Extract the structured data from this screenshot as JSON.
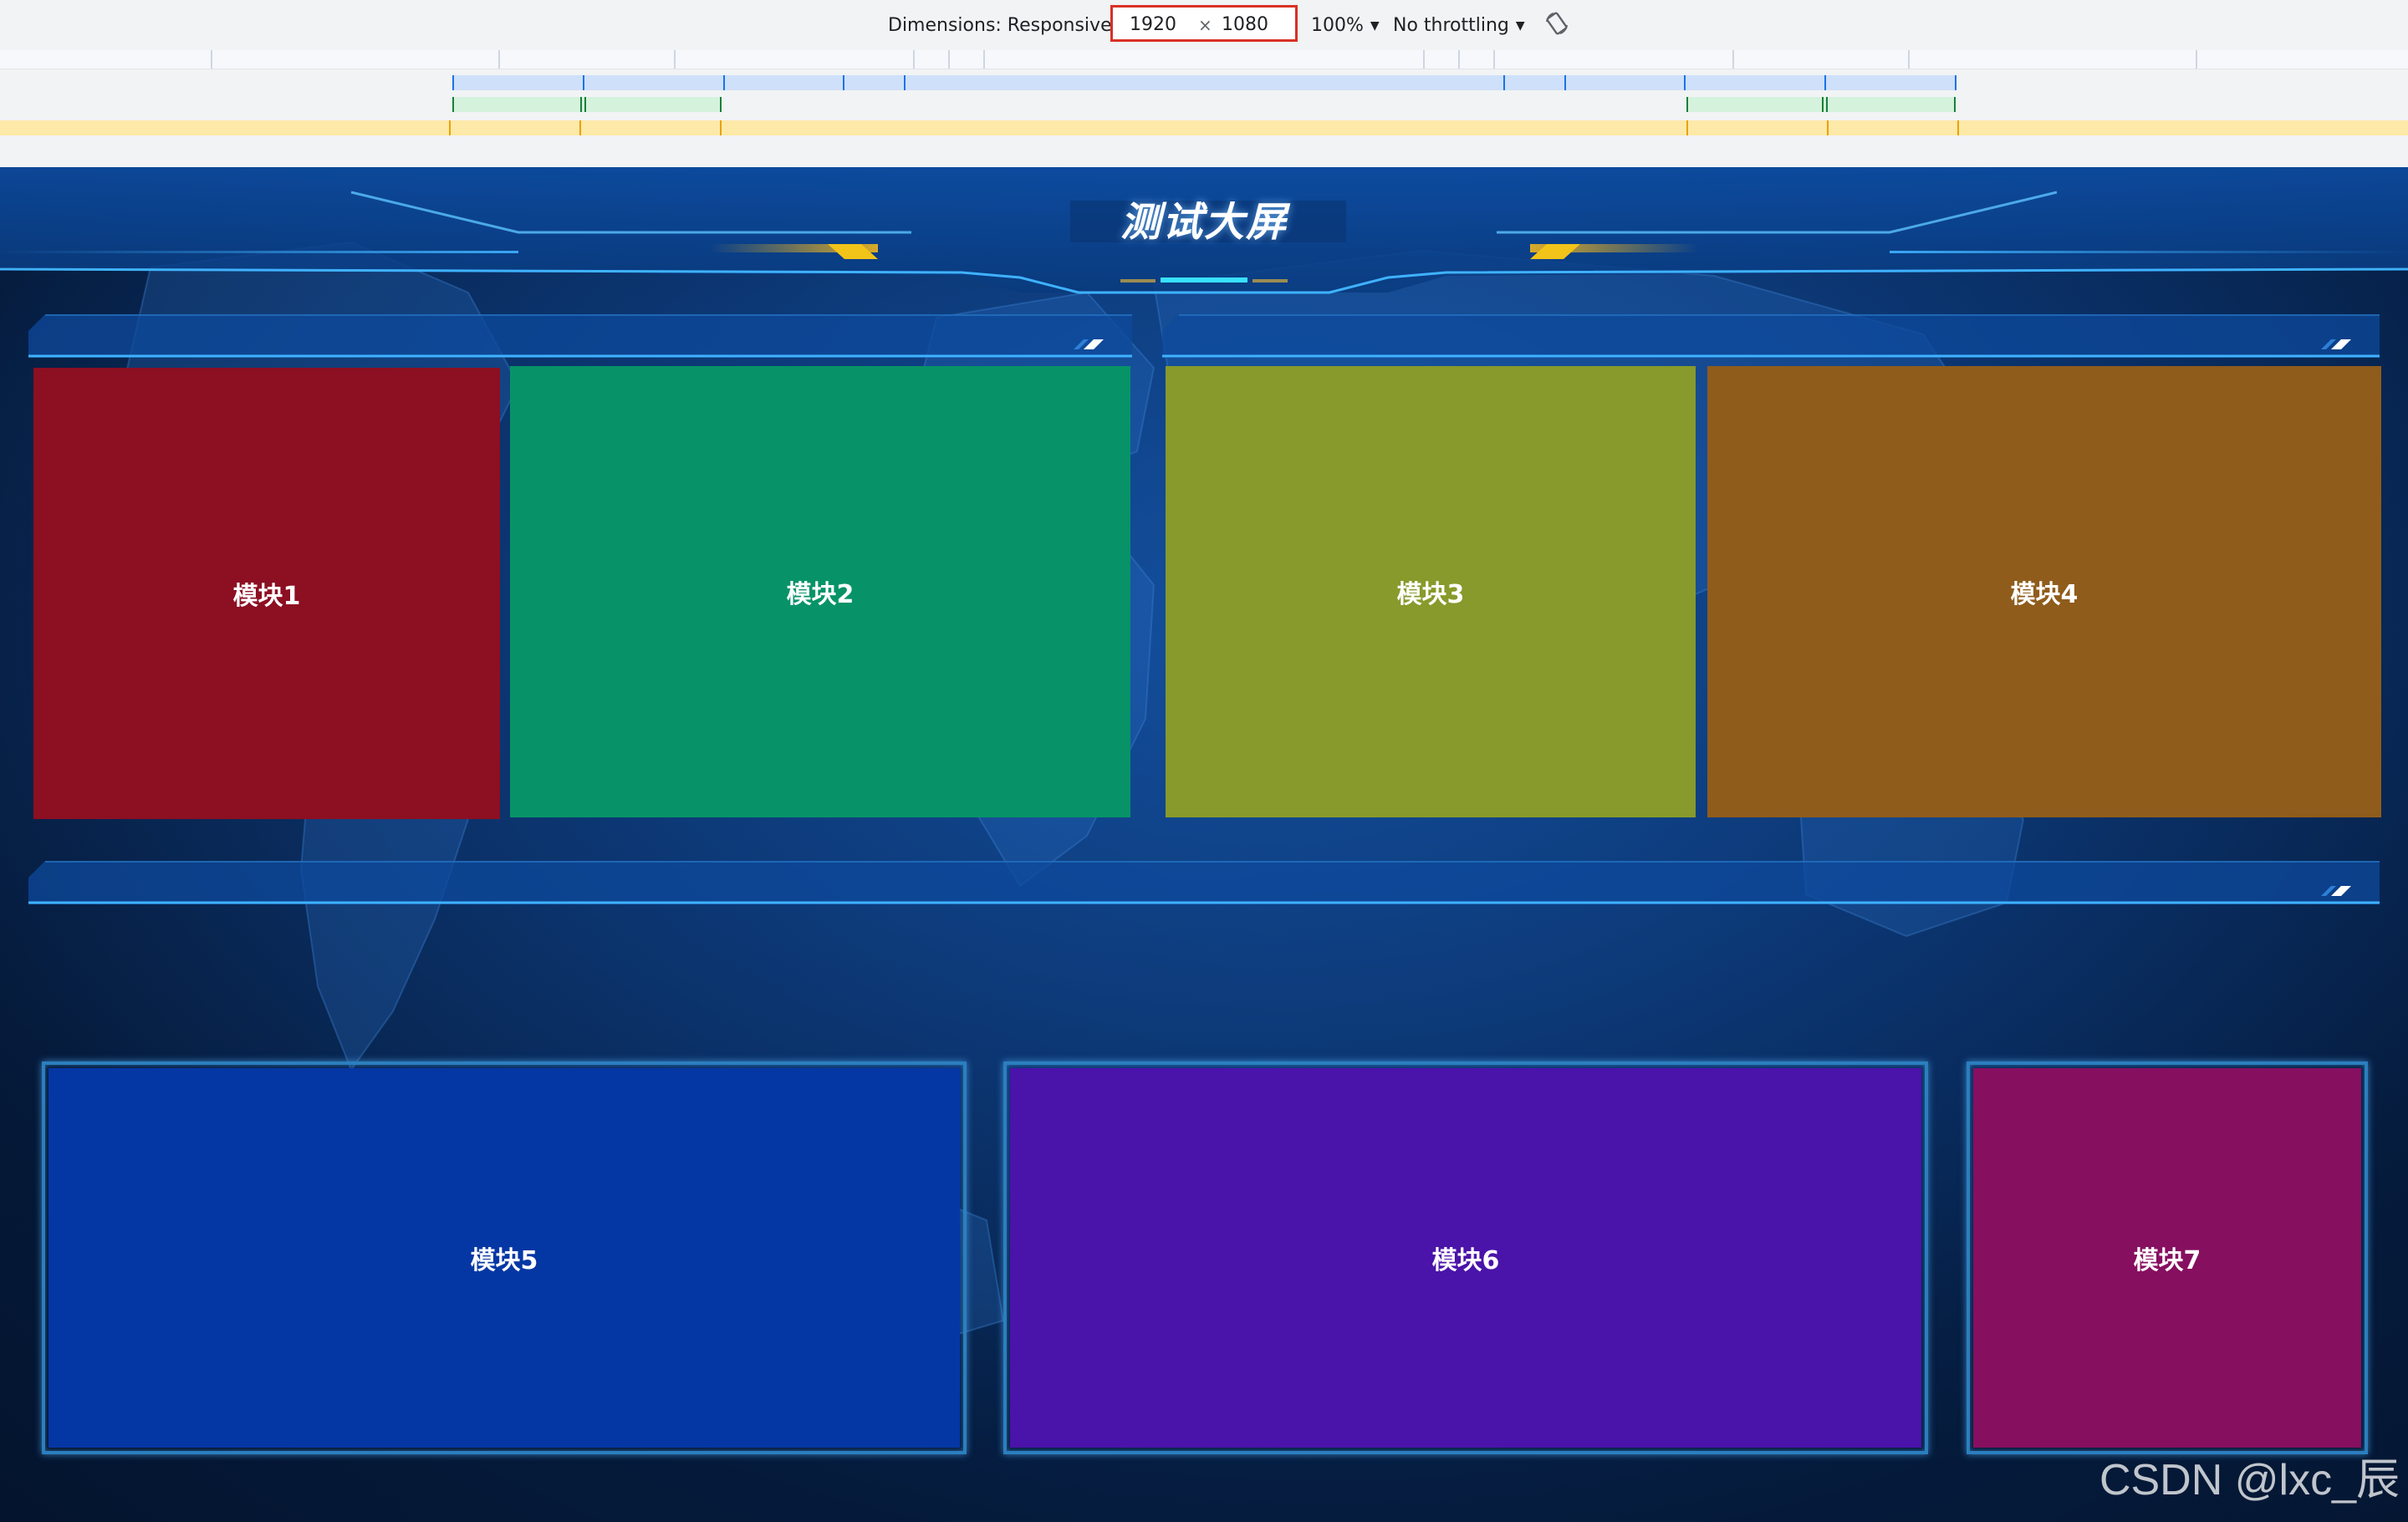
{
  "devtools": {
    "dimensions_label": "Dimensions: Responsive",
    "width_value": "1920",
    "times_sign": "×",
    "height_value": "1080",
    "zoom_label": "100%",
    "throttle_label": "No throttling",
    "rotate_icon": "rotate-icon"
  },
  "screen": {
    "title": "测试大屏",
    "modules": [
      {
        "label": "模块1",
        "color": "#8c0f22"
      },
      {
        "label": "模块2",
        "color": "#079367"
      },
      {
        "label": "模块3",
        "color": "#879a2b"
      },
      {
        "label": "模块4",
        "color": "#8f5c1c"
      },
      {
        "label": "模块5",
        "color": "#0537a4"
      },
      {
        "label": "模块6",
        "color": "#4a13a9"
      },
      {
        "label": "模块7",
        "color": "#860f60"
      }
    ]
  },
  "watermark": "CSDN @lxc_辰"
}
